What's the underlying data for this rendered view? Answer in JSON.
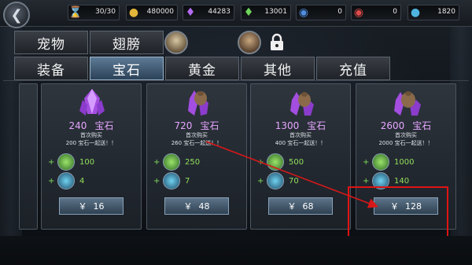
{
  "topbar": {
    "resources": [
      {
        "icon": "hourglass-icon",
        "value": "30/30",
        "color": "#c99a4a"
      },
      {
        "icon": "gold-coin-icon",
        "value": "480000",
        "color": "#e3b53a"
      },
      {
        "icon": "purple-gem-icon",
        "value": "44283",
        "color": "#b46cf0"
      },
      {
        "icon": "green-crystal-icon",
        "value": "13001",
        "color": "#6fd65a"
      },
      {
        "icon": "blue-potion-icon",
        "value": "0",
        "color": "#4f8fe0"
      },
      {
        "icon": "red-potion-icon",
        "value": "0",
        "color": "#e04a4a"
      },
      {
        "icon": "blue-drop-icon",
        "value": "1820",
        "color": "#4fb4e0"
      }
    ]
  },
  "tabs_row1": [
    {
      "label": "宠物"
    },
    {
      "label": "翅膀"
    }
  ],
  "tabs_row2": [
    {
      "label": "装备",
      "active": false
    },
    {
      "label": "宝石",
      "active": true
    },
    {
      "label": "黄金",
      "active": false
    },
    {
      "label": "其他",
      "active": false
    },
    {
      "label": "充值",
      "active": false
    }
  ],
  "cards": [
    {
      "amount": "240",
      "unit": "宝石",
      "first_purchase": "首次购买",
      "bonus": "200 宝石一起送！！",
      "reward1": "100",
      "reward2": "4",
      "currency": "￥",
      "price": "16"
    },
    {
      "amount": "720",
      "unit": "宝石",
      "first_purchase": "首次购买",
      "bonus": "260 宝石一起送！！",
      "reward1": "250",
      "reward2": "7",
      "currency": "￥",
      "price": "48"
    },
    {
      "amount": "1300",
      "unit": "宝石",
      "first_purchase": "首次购买",
      "bonus": "400 宝石一起送！！",
      "reward1": "500",
      "reward2": "70",
      "currency": "￥",
      "price": "68"
    },
    {
      "amount": "2600",
      "unit": "宝石",
      "first_purchase": "首次购买",
      "bonus": "2000 宝石一起送！！",
      "reward1": "1000",
      "reward2": "140",
      "currency": "￥",
      "price": "128"
    }
  ],
  "colors": {
    "accent_purple": "#e6a6ff",
    "reward_green": "#92e05a",
    "highlight_red": "#e01414",
    "arrow_red": "#d81818"
  }
}
